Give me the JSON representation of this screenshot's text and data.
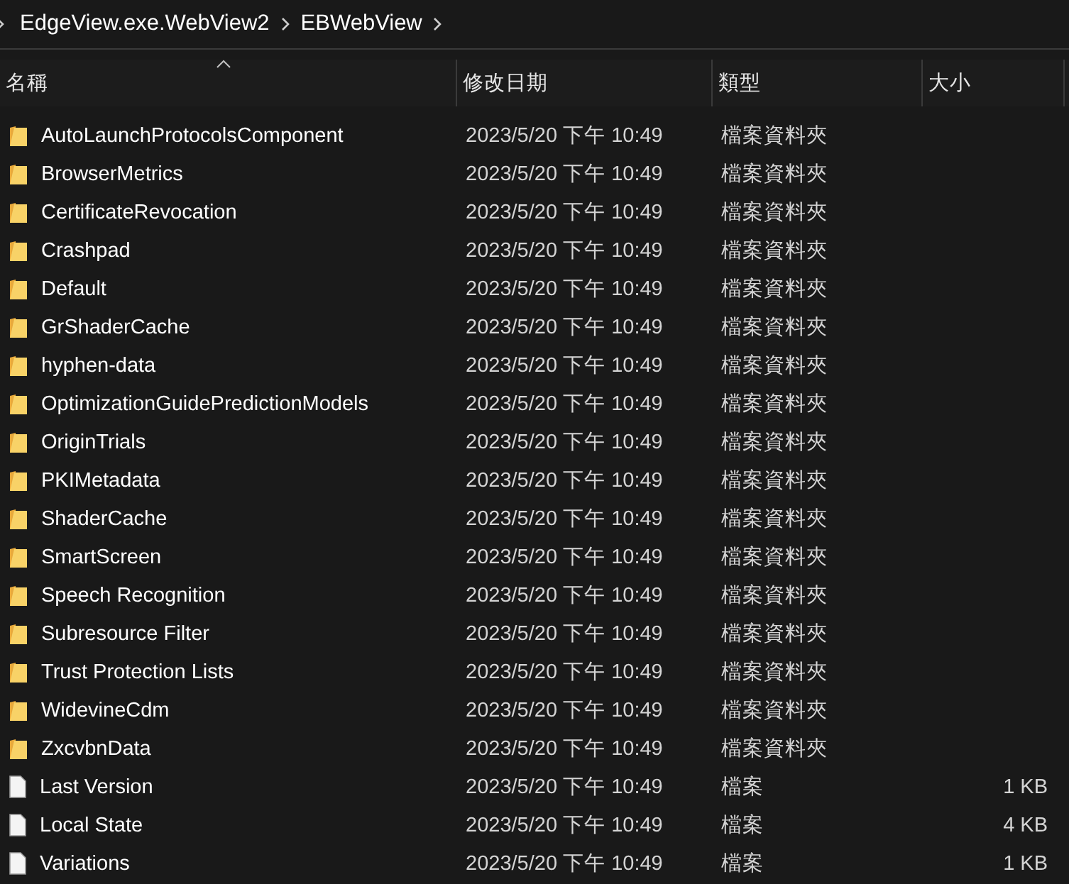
{
  "breadcrumb": [
    "EdgeView.exe.WebView2",
    "EBWebView"
  ],
  "columns": [
    {
      "label": "名稱",
      "sorted": true
    },
    {
      "label": "修改日期",
      "sorted": false
    },
    {
      "label": "類型",
      "sorted": false
    },
    {
      "label": "大小",
      "sorted": false
    }
  ],
  "rows": [
    {
      "kind": "folder",
      "name": "AutoLaunchProtocolsComponent",
      "modified": "2023/5/20 下午 10:49",
      "type": "檔案資料夾"
    },
    {
      "kind": "folder",
      "name": "BrowserMetrics",
      "modified": "2023/5/20 下午 10:49",
      "type": "檔案資料夾"
    },
    {
      "kind": "folder",
      "name": "CertificateRevocation",
      "modified": "2023/5/20 下午 10:49",
      "type": "檔案資料夾"
    },
    {
      "kind": "folder",
      "name": "Crashpad",
      "modified": "2023/5/20 下午 10:49",
      "type": "檔案資料夾"
    },
    {
      "kind": "folder",
      "name": "Default",
      "modified": "2023/5/20 下午 10:49",
      "type": "檔案資料夾"
    },
    {
      "kind": "folder",
      "name": "GrShaderCache",
      "modified": "2023/5/20 下午 10:49",
      "type": "檔案資料夾"
    },
    {
      "kind": "folder",
      "name": "hyphen-data",
      "modified": "2023/5/20 下午 10:49",
      "type": "檔案資料夾"
    },
    {
      "kind": "folder",
      "name": "OptimizationGuidePredictionModels",
      "modified": "2023/5/20 下午 10:49",
      "type": "檔案資料夾"
    },
    {
      "kind": "folder",
      "name": "OriginTrials",
      "modified": "2023/5/20 下午 10:49",
      "type": "檔案資料夾"
    },
    {
      "kind": "folder",
      "name": "PKIMetadata",
      "modified": "2023/5/20 下午 10:49",
      "type": "檔案資料夾"
    },
    {
      "kind": "folder",
      "name": "ShaderCache",
      "modified": "2023/5/20 下午 10:49",
      "type": "檔案資料夾"
    },
    {
      "kind": "folder",
      "name": "SmartScreen",
      "modified": "2023/5/20 下午 10:49",
      "type": "檔案資料夾"
    },
    {
      "kind": "folder",
      "name": "Speech Recognition",
      "modified": "2023/5/20 下午 10:49",
      "type": "檔案資料夾"
    },
    {
      "kind": "folder",
      "name": "Subresource Filter",
      "modified": "2023/5/20 下午 10:49",
      "type": "檔案資料夾"
    },
    {
      "kind": "folder",
      "name": "Trust Protection Lists",
      "modified": "2023/5/20 下午 10:49",
      "type": "檔案資料夾"
    },
    {
      "kind": "folder",
      "name": "WidevineCdm",
      "modified": "2023/5/20 下午 10:49",
      "type": "檔案資料夾"
    },
    {
      "kind": "folder",
      "name": "ZxcvbnData",
      "modified": "2023/5/20 下午 10:49",
      "type": "檔案資料夾"
    },
    {
      "kind": "file",
      "name": "Last Version",
      "modified": "2023/5/20 下午 10:49",
      "type": "檔案",
      "size": "1 KB"
    },
    {
      "kind": "file",
      "name": "Local State",
      "modified": "2023/5/20 下午 10:49",
      "type": "檔案",
      "size": "4 KB"
    },
    {
      "kind": "file",
      "name": "Variations",
      "modified": "2023/5/20 下午 10:49",
      "type": "檔案",
      "size": "1 KB"
    }
  ]
}
